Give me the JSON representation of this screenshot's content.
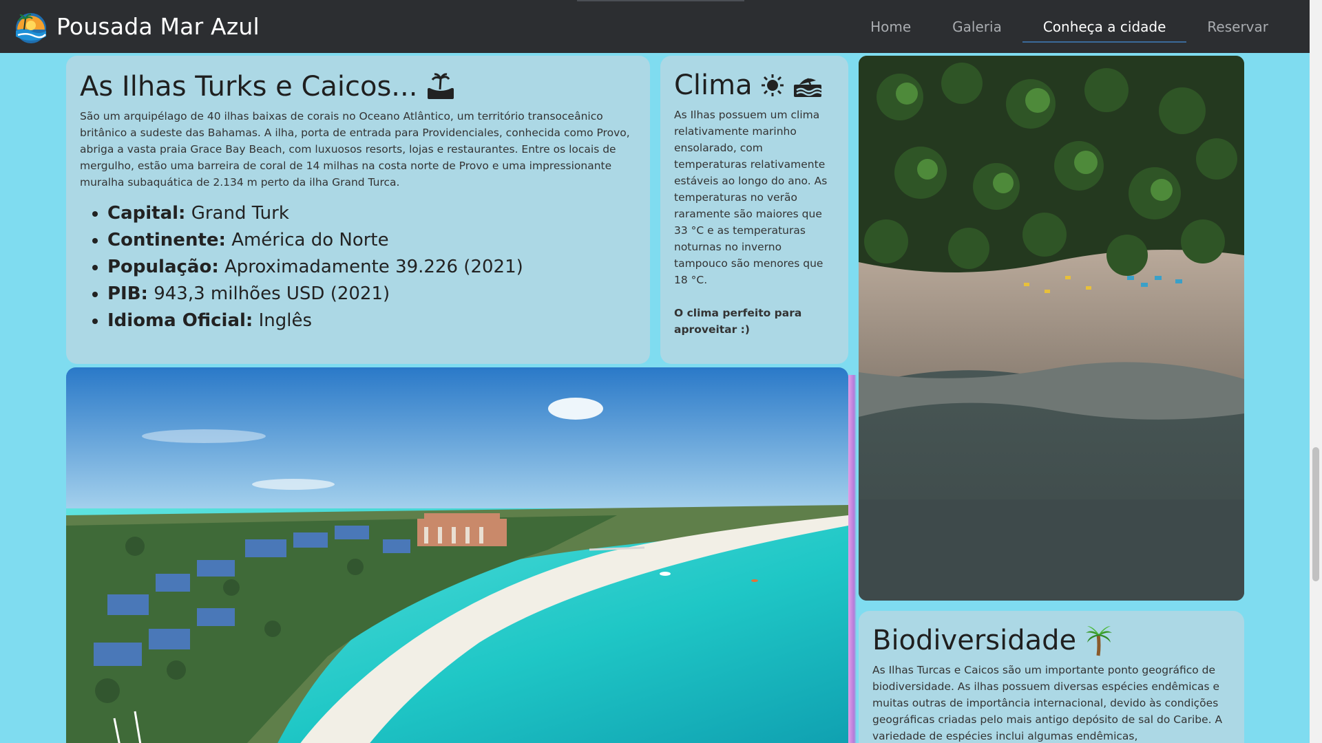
{
  "header": {
    "brand_name": "Pousada Mar Azul",
    "nav": [
      {
        "label": "Home",
        "active": false
      },
      {
        "label": "Galeria",
        "active": false
      },
      {
        "label": "Conheça a cidade",
        "active": true
      },
      {
        "label": "Reservar",
        "active": false
      }
    ]
  },
  "turks": {
    "title": "As Ilhas Turks e Caicos...",
    "title_icon": "island-icon",
    "description": "São um arquipélago de 40 ilhas baixas de corais no Oceano Atlântico, um território transoceânico britânico a sudeste das Bahamas. A ilha, porta de entrada para Providenciales, conhecida como Provo, abriga a vasta praia Grace Bay Beach, com luxuosos resorts, lojas e restaurantes. Entre os locais de mergulho, estão uma barreira de coral de 14 milhas na costa norte de Provo e uma impressionante muralha subaquática de 2.134 m perto da ilha Grand Turca.",
    "facts": [
      {
        "label": "Capital:",
        "value": "Grand Turk"
      },
      {
        "label": "Continente:",
        "value": "América do Norte"
      },
      {
        "label": "População:",
        "value": "Aproximadamente 39.226 (2021)"
      },
      {
        "label": "PIB:",
        "value": "943,3 milhões USD (2021)"
      },
      {
        "label": "Idioma Oficial:",
        "value": "Inglês"
      }
    ]
  },
  "clima": {
    "title": "Clima",
    "title_icons": [
      "sun-icon",
      "beach-icon"
    ],
    "description": "As Ilhas possuem um clima relativamente marinho ensolarado, com temperaturas relativamente estáveis ao longo do ano. As temperaturas no verão raramente são maiores que 33 °C e as temperaturas noturnas no inverno tampouco são menores que 18 °C.",
    "highlight": "O clima perfeito para aproveitar :)"
  },
  "bio": {
    "title": "Biodiversidade",
    "title_icon": "palm-tree-icon",
    "description": "As Ilhas Turcas e Caicos são um importante ponto geográfico de biodiversidade. As ilhas possuem diversas espécies endêmicas e muitas outras de importância internacional, devido às condições geográficas criadas pelo mais antigo depósito de sal do Caribe. A variedade de espécies inclui algumas endêmicas,"
  },
  "colors": {
    "navbar": "#2c2e31",
    "page_bg": "#7fdcf0",
    "card_bg": "#acd8e5",
    "nav_active_underline": "#3b6a9a"
  }
}
